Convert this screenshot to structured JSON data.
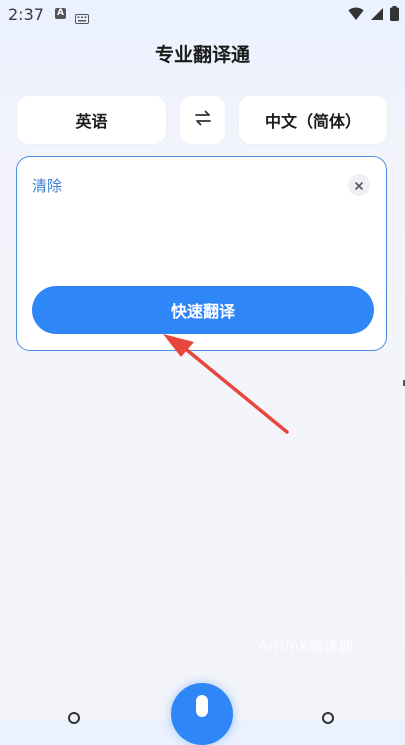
{
  "status_bar": {
    "time": "2:37",
    "notification_letter": "A"
  },
  "header": {
    "title": "专业翻译通"
  },
  "languages": {
    "source": "英语",
    "target": "中文（简体）"
  },
  "input": {
    "clear_label": "清除",
    "translate_button": "快速翻译"
  },
  "watermark": "Airlink极速翻",
  "colors": {
    "accent": "#2f86f6",
    "border": "#4a90e2",
    "annotation_arrow": "#e8453c"
  }
}
